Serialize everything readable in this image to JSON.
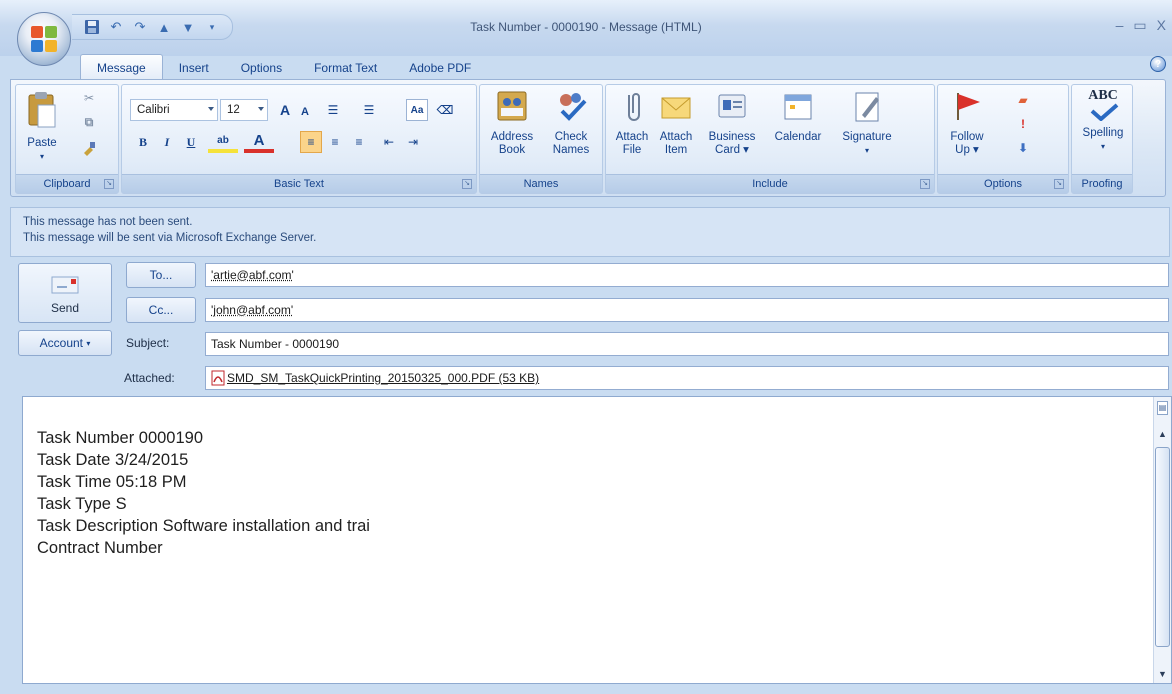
{
  "window": {
    "title": "Task Number - 0000190 - Message (HTML)",
    "controls": {
      "minimize": "–",
      "maximize": "▭",
      "close": "X"
    }
  },
  "qat": {
    "items": [
      "save-icon",
      "undo-icon",
      "redo-icon",
      "up-arrow-icon",
      "down-arrow-icon",
      "customize-icon"
    ]
  },
  "tabs": [
    {
      "label": "Message",
      "active": true
    },
    {
      "label": "Insert",
      "active": false
    },
    {
      "label": "Options",
      "active": false
    },
    {
      "label": "Format Text",
      "active": false
    },
    {
      "label": "Adobe PDF",
      "active": false
    }
  ],
  "ribbon": {
    "clipboard": {
      "label": "Clipboard",
      "paste": "Paste"
    },
    "basic_text": {
      "label": "Basic Text",
      "font": "Calibri",
      "size": "12",
      "bold": "B",
      "italic": "I",
      "underline": "U",
      "grow": "A",
      "shrink": "A"
    },
    "names": {
      "label": "Names",
      "address_book": [
        "Address",
        "Book"
      ],
      "check_names": [
        "Check",
        "Names"
      ]
    },
    "include": {
      "label": "Include",
      "attach_file": [
        "Attach",
        "File"
      ],
      "attach_item": [
        "Attach",
        "Item"
      ],
      "business_card": [
        "Business",
        "Card"
      ],
      "calendar": "Calendar",
      "signature": "Signature"
    },
    "options": {
      "label": "Options",
      "follow_up": [
        "Follow",
        "Up"
      ]
    },
    "proofing": {
      "label": "Proofing",
      "spelling": "Spelling",
      "abc": "ABC"
    }
  },
  "info": {
    "line1": "This message has not been sent.",
    "line2": "This message will be sent via Microsoft Exchange Server."
  },
  "header": {
    "send": "Send",
    "to_button": "To...",
    "cc_button": "Cc...",
    "account_button": "Account",
    "subject_label": "Subject:",
    "attached_label": "Attached:",
    "to_value": "'artie@abf.com'",
    "cc_value": "'john@abf.com'",
    "subject_value": "Task Number - 0000190",
    "attachment_value": "SMD_SM_TaskQuickPrinting_20150325_000.PDF (53 KB)"
  },
  "body": {
    "lines": [
      "Task Number 0000190",
      "Task Date 3/24/2015",
      "Task Time 05:18 PM",
      "Task Type S",
      "Task Description Software installation and trai",
      "Contract Number"
    ]
  },
  "colors": {
    "ribbon": "#dbe7f5",
    "accent": "#15428b",
    "flag": "#d9312b"
  }
}
